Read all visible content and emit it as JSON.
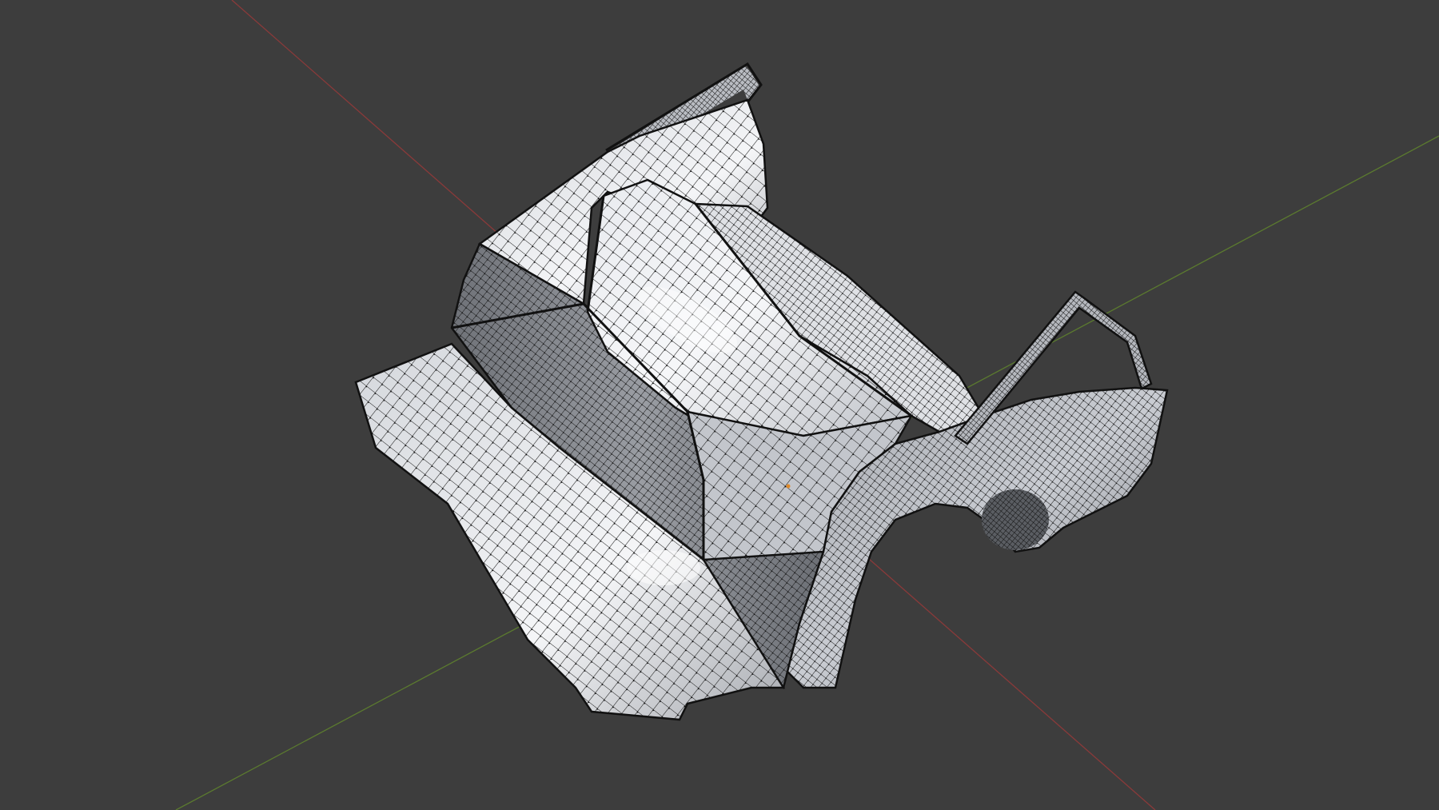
{
  "viewport": {
    "mode": "Edit Mode",
    "shading": "solid-with-wireframe-overlay",
    "background_color": "#3d3d3d",
    "grid_floor": false
  },
  "axes": [
    {
      "name": "x-axis-line",
      "color": "#8a3a3a"
    },
    {
      "name": "y-axis-line",
      "color": "#5b7a2f"
    }
  ],
  "mesh": {
    "name": "car-body-wireframe",
    "surface_light": "#f2f4f6",
    "surface_mid": "#c9ccd2",
    "surface_dark": "#8d9097",
    "wire_color": "#1a1a1a",
    "vertex_color": "#0a0a0a",
    "parts": [
      "left-wing-panel",
      "left-side-wall",
      "center-hood-panel",
      "right-hood-strip",
      "rear-nose-panel",
      "right-fender-arch",
      "left-support-strut",
      "right-support-strut"
    ]
  }
}
